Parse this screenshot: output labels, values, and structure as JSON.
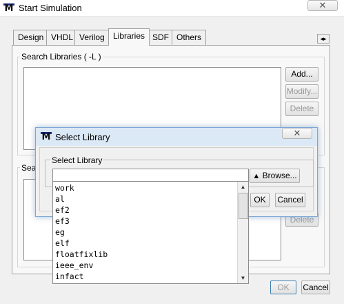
{
  "window": {
    "title": "Start Simulation",
    "logo": "M",
    "close_glyph": "✕",
    "tabs": [
      "Design",
      "VHDL",
      "Verilog",
      "Libraries",
      "SDF",
      "Others"
    ],
    "active_tab": "Libraries",
    "tab_scroll_left": "◂",
    "tab_scroll_right": "▸",
    "search_libraries": {
      "legend": "Search Libraries ( -L )",
      "add_label": "Add...",
      "modify_label": "Modify...",
      "delete_label": "Delete"
    },
    "second_group": {
      "legend_partial": "Sear",
      "delete_label": "Delete"
    },
    "ok_label": "OK",
    "cancel_label": "Cancel"
  },
  "dialog": {
    "title": "Select Library",
    "logo": "M",
    "close_glyph": "✕",
    "group_label": "Select Library",
    "input_value": "",
    "browse_arrow": "▲",
    "browse_label": "Browse...",
    "ok_label": "OK",
    "cancel_label": "Cancel",
    "dropdown_items": [
      "work",
      "al",
      "ef2",
      "ef3",
      "eg",
      "elf",
      "floatfixlib",
      "ieee_env",
      "infact"
    ],
    "scroll_up": "▲",
    "scroll_down": "▼"
  }
}
